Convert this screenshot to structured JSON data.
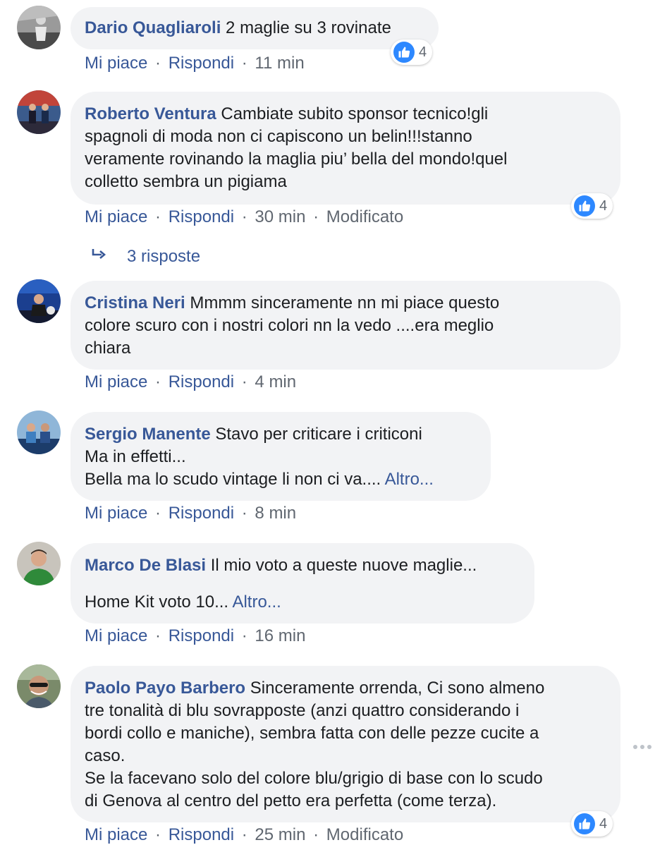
{
  "comments": [
    {
      "author": "Dario Quagliaroli",
      "lines": [
        "2 maglie su 3 rovinate"
      ],
      "like": "Mi piace",
      "reply": "Rispondi",
      "time": "11 min",
      "reactions": "4"
    },
    {
      "author": "Roberto Ventura",
      "lines": [
        "Cambiate subito sponsor tecnico!gli",
        "spagnoli di moda non ci capiscono un belin!!!stanno",
        "veramente rovinando la maglia piu’ bella del mondo!quel",
        "colletto sembra un pigiama"
      ],
      "like": "Mi piace",
      "reply": "Rispondi",
      "time": "30 min",
      "edited": "Modificato",
      "reactions": "4",
      "replies_label": "3 risposte"
    },
    {
      "author": "Cristina Neri",
      "lines": [
        "Mmmm sinceramente nn mi piace questo",
        "colore scuro con i nostri colori nn la vedo ....era meglio",
        "chiara"
      ],
      "like": "Mi piace",
      "reply": "Rispondi",
      "time": "4 min"
    },
    {
      "author": "Sergio Manente",
      "lines": [
        "Stavo per criticare i criticoni",
        "Ma in effetti...",
        "Bella ma lo scudo vintage li non ci va.... "
      ],
      "more": "Altro...",
      "like": "Mi piace",
      "reply": "Rispondi",
      "time": "8 min"
    },
    {
      "author": "Marco De Blasi",
      "lines": [
        "Il mio voto a queste nuove maglie...",
        "Home Kit voto 10... "
      ],
      "more": "Altro...",
      "like": "Mi piace",
      "reply": "Rispondi",
      "time": "16 min"
    },
    {
      "author": "Paolo Payo Barbero",
      "lines": [
        "Sinceramente orrenda, Ci sono almeno",
        "tre tonalità di blu sovrapposte (anzi quattro considerando i",
        "bordi collo e maniche), sembra fatta con delle pezze cucite a",
        "caso.",
        "Se la facevano solo del colore blu/grigio di base con lo scudo",
        "di Genova al centro del petto era perfetta (come terza)."
      ],
      "like": "Mi piace",
      "reply": "Rispondi",
      "time": "25 min",
      "edited": "Modificato",
      "reactions": "4"
    }
  ],
  "colors": {
    "link": "#385898",
    "bubble": "#f2f3f5",
    "meta": "#606770",
    "like": "#2d88ff"
  },
  "icons": {
    "like": "thumbs-up-icon",
    "reply_arrow": "reply-arrow-icon",
    "options": "more-options-icon"
  }
}
